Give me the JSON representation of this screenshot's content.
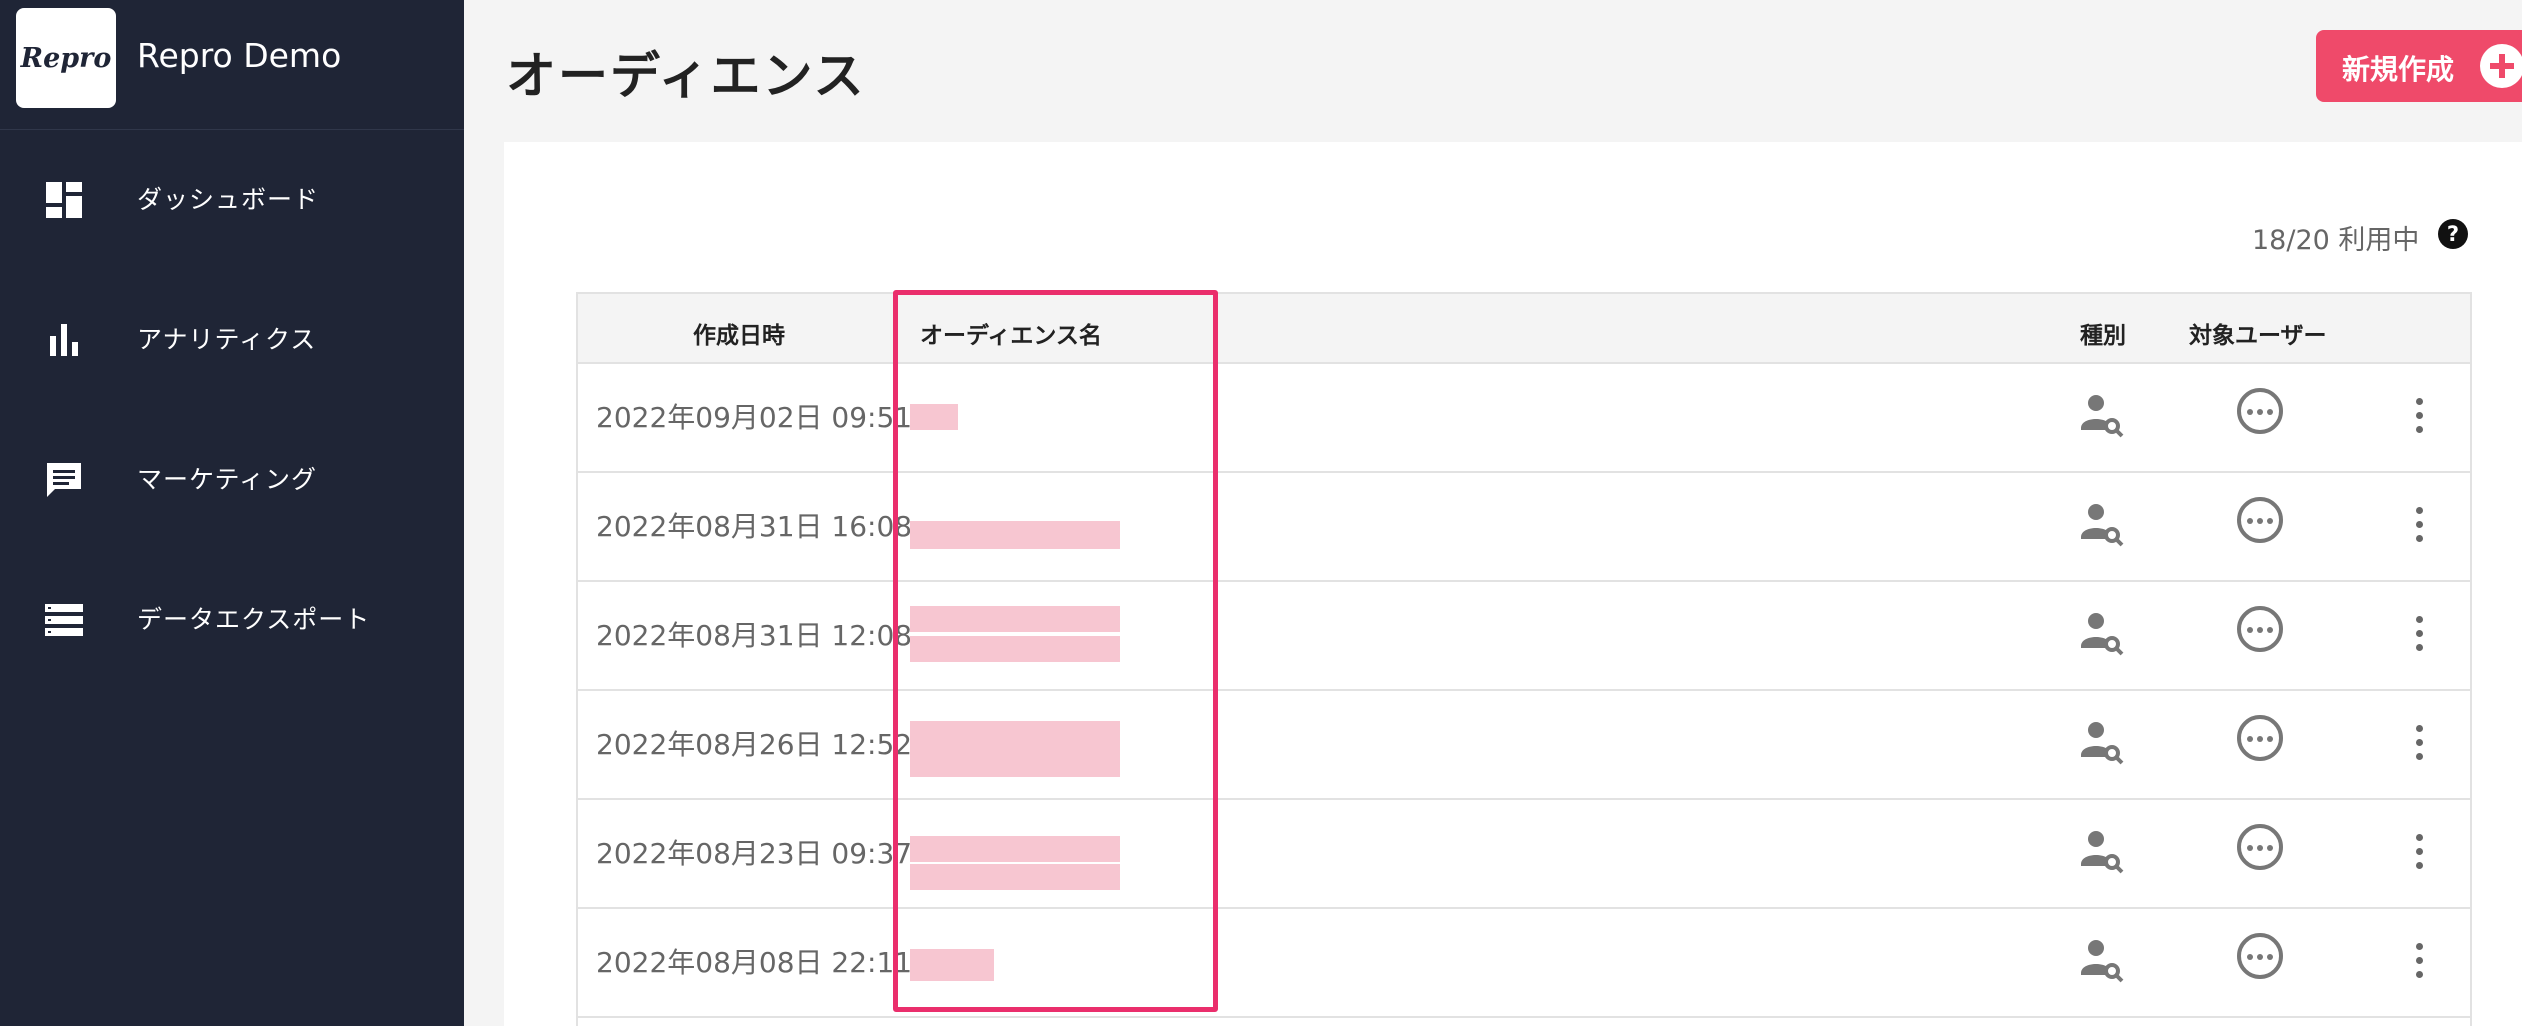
{
  "app": {
    "name": "Repro Demo",
    "logo_text": "Repro"
  },
  "sidebar": {
    "items": [
      {
        "label": "ダッシュボード",
        "icon": "dashboard-icon"
      },
      {
        "label": "アナリティクス",
        "icon": "bar-chart-icon"
      },
      {
        "label": "マーケティング",
        "icon": "message-icon"
      },
      {
        "label": "データエクスポート",
        "icon": "list-icon"
      }
    ]
  },
  "header": {
    "title": "オーディエンス",
    "new_button_label": "新規作成"
  },
  "usage": {
    "text": "18/20 利用中",
    "used": 18,
    "limit": 20,
    "help_icon": "help-icon"
  },
  "table": {
    "columns": {
      "created": "作成日時",
      "name": "オーディエンス名",
      "kind": "種別",
      "users": "対象ユーザー"
    },
    "rows": [
      {
        "created": "2022年09月02日 09:51"
      },
      {
        "created": "2022年08月31日 16:08"
      },
      {
        "created": "2022年08月31日 12:08"
      },
      {
        "created": "2022年08月26日 12:52"
      },
      {
        "created": "2022年08月23日 09:37"
      },
      {
        "created": "2022年08月08日 22:11"
      }
    ]
  },
  "colors": {
    "sidebar": "#1f2536",
    "accent": "#ef4a6a",
    "highlight": "#ea2e6c"
  }
}
